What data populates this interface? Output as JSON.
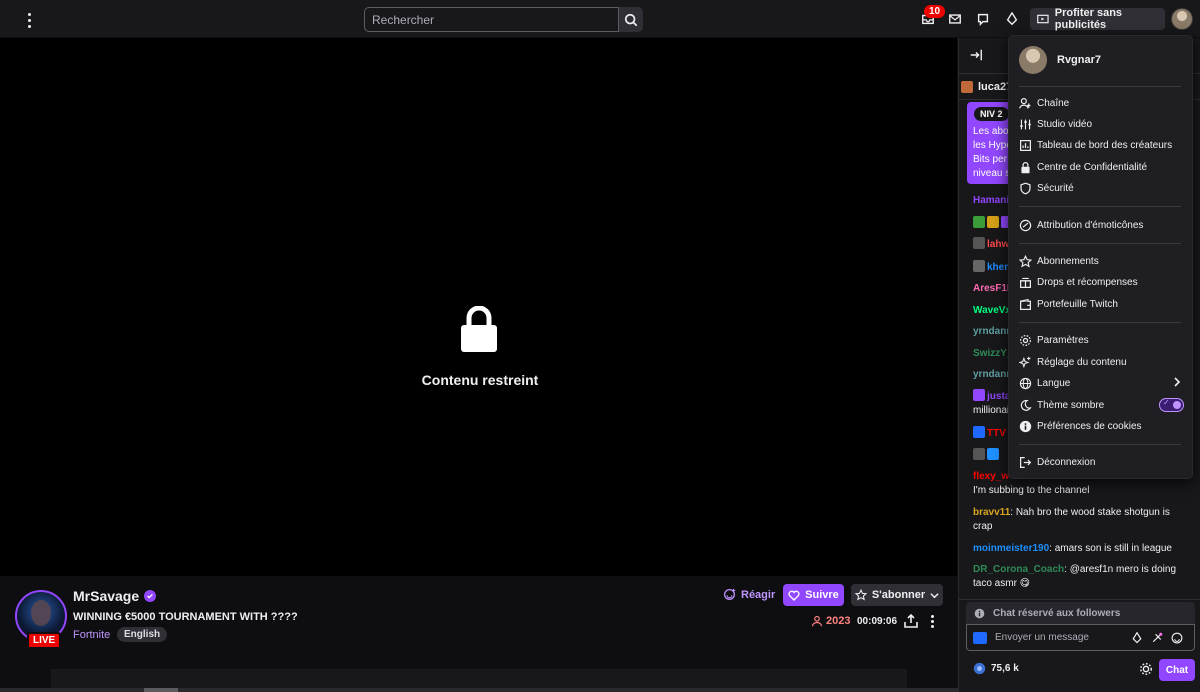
{
  "topnav": {
    "search_placeholder": "Rechercher",
    "notif_count": "10",
    "noads_label": "Profiter sans publicités"
  },
  "player": {
    "restricted_label": "Contenu restreint"
  },
  "channel": {
    "name": "MrSavage",
    "live_label": "LIVE",
    "title": "WINNING €5000 TOURNAMENT WITH ????",
    "game": "Fortnite",
    "tag": "English",
    "react_label": "Réagir",
    "follow_label": "Suivre",
    "subscribe_label": "S'abonner",
    "viewers": "2023",
    "uptime": "00:09:06"
  },
  "chat": {
    "pinned_user": "luca27_",
    "hype": {
      "level": "NIV 2",
      "lines": [
        "Les abo",
        "les Hype",
        "Bits per",
        "niveau s"
      ]
    },
    "messages": [
      {
        "user": "Hamani",
        "text": "",
        "color": "#9147ff"
      },
      {
        "user": "lahw",
        "text": "",
        "color": "#ff4a4a"
      },
      {
        "user": "kher",
        "text": "",
        "color": "#1e90ff"
      },
      {
        "user": "AresF1N",
        "text": "",
        "color": "#ff69b4"
      },
      {
        "user": "WaveVx",
        "text": "",
        "color": "#00ff7f"
      },
      {
        "user": "yrndanr",
        "text": "",
        "color": "#5f9ea0"
      },
      {
        "user": "SwizzY_",
        "text": "",
        "color": "#2e8b57"
      },
      {
        "user": "yrndanr",
        "text": "",
        "color": "#5f9ea0"
      },
      {
        "user": "justa",
        "text": "",
        "color": "#9147ff"
      },
      {
        "user": "",
        "text": "millionai",
        "color": "#efeff1"
      },
      {
        "user": "TTV",
        "text": "",
        "color": "#ff0000"
      },
      {
        "user": "flexy_w",
        "text": "I'm subbing to the channel",
        "color": "#ff0000"
      },
      {
        "user": "bravv11",
        "text": "Nah bro the wood stake shotgun is crap",
        "color": "#daa520"
      },
      {
        "user": "moinmeister190",
        "text": "amars son is still in league",
        "color": "#1e90ff"
      },
      {
        "user": "DR_Corona_Coach",
        "text": "@aresf1n mero is doing taco asmr 😋",
        "color": "#2e8b57"
      }
    ],
    "followers_only": "Chat réservé aux followers",
    "input_placeholder": "Envoyer un message",
    "points": "75,6 k",
    "chat_button": "Chat"
  },
  "menu": {
    "username": "Rvgnar7",
    "items": [
      "Chaîne",
      "Studio vidéo",
      "Tableau de bord des créateurs",
      "Centre de Confidentialité",
      "Sécurité",
      "Attribution d'émoticônes",
      "Abonnements",
      "Drops et récompenses",
      "Portefeuille Twitch",
      "Paramètres",
      "Réglage du contenu",
      "Langue",
      "Thème sombre",
      "Préférences de cookies",
      "Déconnexion"
    ],
    "dark_theme_on": true
  },
  "colors": {
    "accent": "#9147ff",
    "live": "#eb0400",
    "background": "#0e0e10"
  }
}
